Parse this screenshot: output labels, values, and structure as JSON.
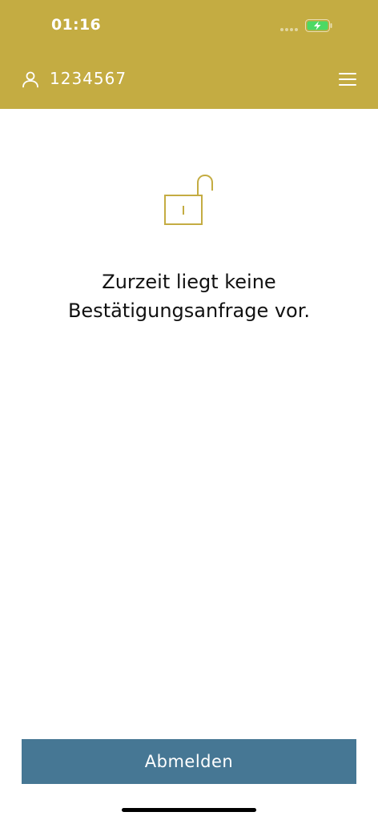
{
  "status_bar": {
    "time": "01:16"
  },
  "header": {
    "account_number": "1234567",
    "user_icon": "user-icon",
    "menu_icon": "hamburger-menu-icon"
  },
  "main": {
    "icon": "unlocked-padlock-icon",
    "message_line1": "Zurzeit liegt keine",
    "message_line2": "Bestätigungsanfrage vor."
  },
  "footer": {
    "logout_label": "Abmelden"
  },
  "colors": {
    "header_bg": "#c4ac42",
    "accent_gold": "#c4ac42",
    "button_bg": "#467794",
    "battery_green": "#4cd964"
  }
}
